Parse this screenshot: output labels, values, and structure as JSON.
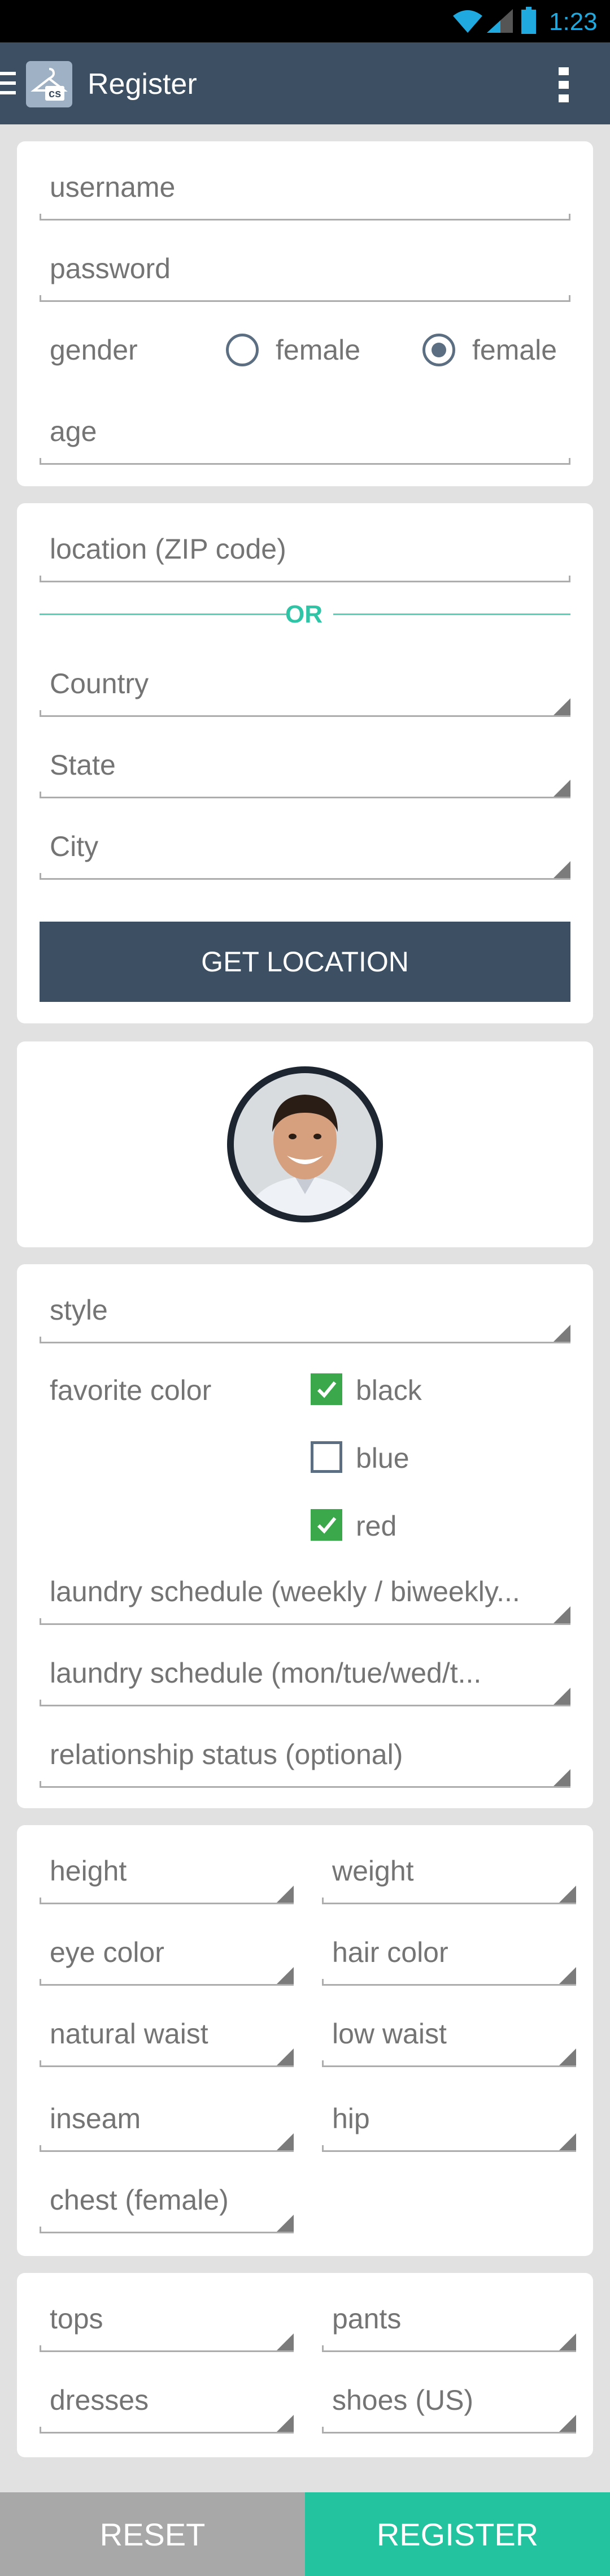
{
  "status_bar": {
    "time": "1:23",
    "icons": [
      "wifi-icon",
      "signal-icon",
      "battery-icon"
    ]
  },
  "action_bar": {
    "title": "Register",
    "logo_text": "cs",
    "icons": [
      "menu-icon",
      "app-logo-icon",
      "overflow-menu-icon"
    ]
  },
  "account": {
    "username_placeholder": "username",
    "password_placeholder": "password",
    "gender_label": "gender",
    "gender_options": [
      {
        "label": "female",
        "selected": false
      },
      {
        "label": "female",
        "selected": true
      }
    ],
    "age_placeholder": "age"
  },
  "location": {
    "zip_placeholder": "location (ZIP code)",
    "or_text": "OR",
    "country": "Country",
    "state": "State",
    "city": "City",
    "get_location_label": "GET LOCATION"
  },
  "preferences": {
    "style": "style",
    "favorite_color_label": "favorite color",
    "colors": [
      {
        "label": "black",
        "checked": true
      },
      {
        "label": "blue",
        "checked": false
      },
      {
        "label": "red",
        "checked": true
      }
    ],
    "laundry_frequency": "laundry schedule (weekly / biweekly...",
    "laundry_days": "laundry schedule (mon/tue/wed/t...",
    "relationship": "relationship status (optional)"
  },
  "measurements": {
    "height": "height",
    "weight": "weight",
    "eye_color": "eye color",
    "hair_color": "hair color",
    "natural_waist": "natural waist",
    "low_waist": "low waist",
    "inseam": "inseam",
    "hip": "hip",
    "chest": "chest (female)"
  },
  "sizes": {
    "tops": "tops",
    "pants": "pants",
    "dresses": "dresses",
    "shoes": "shoes (US)"
  },
  "footer": {
    "reset_label": "RESET",
    "register_label": "REGISTER"
  },
  "colors": {
    "action_bar": "#3d4f62",
    "accent": "#24c39f",
    "checked": "#3aa84b",
    "status_time": "#1fa9de"
  }
}
